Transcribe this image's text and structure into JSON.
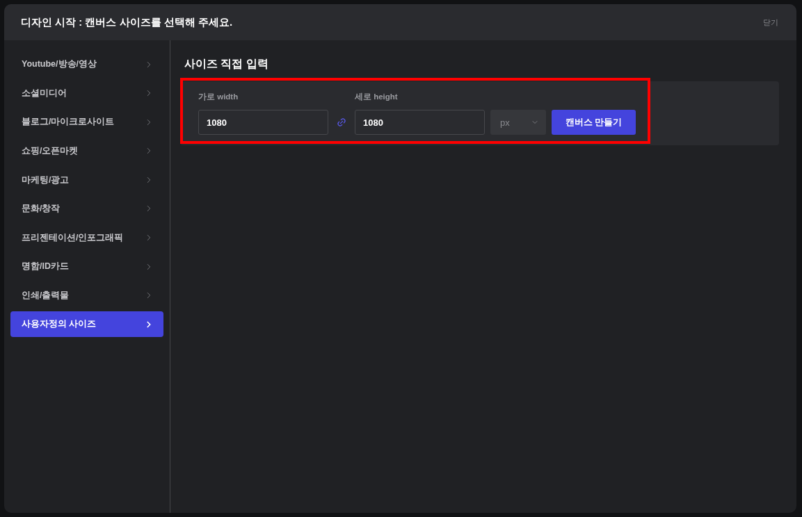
{
  "dialog": {
    "title": "디자인 시작 : 캔버스 사이즈를 선택해 주세요.",
    "close_label": "닫기"
  },
  "sidebar": {
    "items": [
      {
        "label": "Youtube/방송/영상",
        "selected": false
      },
      {
        "label": "소셜미디어",
        "selected": false
      },
      {
        "label": "블로그/마이크로사이트",
        "selected": false
      },
      {
        "label": "쇼핑/오픈마켓",
        "selected": false
      },
      {
        "label": "마케팅/광고",
        "selected": false
      },
      {
        "label": "문화/창작",
        "selected": false
      },
      {
        "label": "프리젠테이션/인포그래픽",
        "selected": false
      },
      {
        "label": "명함/ID카드",
        "selected": false
      },
      {
        "label": "인쇄/출력물",
        "selected": false
      },
      {
        "label": "사용자정의 사이즈",
        "selected": true
      }
    ]
  },
  "custom_size": {
    "heading": "사이즈 직접 입력",
    "width_label": "가로 width",
    "width_value": "1080",
    "height_label": "세로 height",
    "height_value": "1080",
    "unit": "px",
    "create_button": "캔버스 만들기"
  }
}
